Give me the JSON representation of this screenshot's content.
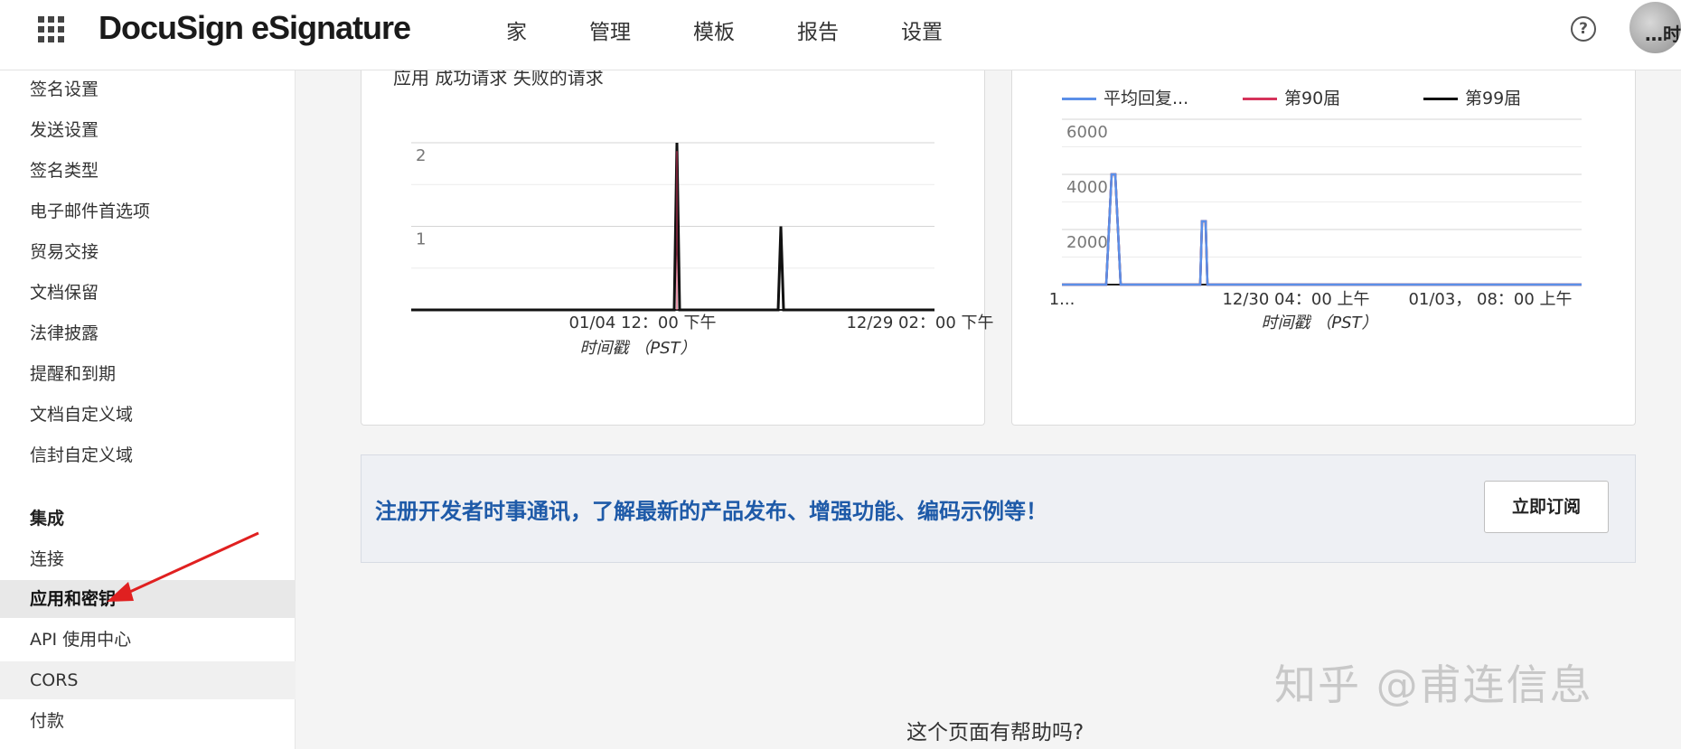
{
  "header": {
    "brand": "DocuSign eSignature",
    "nav": [
      "家",
      "管理",
      "模板",
      "报告",
      "设置"
    ],
    "help": "?",
    "avatar_text": "…时"
  },
  "sidebar": {
    "items_top": [
      "签名设置",
      "发送设置",
      "签名类型",
      "电子邮件首选项",
      "贸易交接",
      "文档保留",
      "法律披露",
      "提醒和到期",
      "文档自定义域",
      "信封自定义域"
    ],
    "integration_heading": "集成",
    "items_integration": [
      "连接",
      "应用和密钥",
      "API 使用中心",
      "CORS",
      "付款"
    ]
  },
  "chart_left": {
    "title": "应用 成功请求 失败的请求",
    "xaxis_title": "时间戳 （PST）"
  },
  "chart_right": {
    "xaxis_title": "时间戳 （PST）"
  },
  "chart_data": [
    {
      "type": "line",
      "title": "应用 成功请求 失败的请求",
      "xlabel": "时间戳 （PST）",
      "ylabel": "",
      "ylim": [
        0,
        2
      ],
      "yticks": [
        1,
        2
      ],
      "xtick_labels": [
        "01/04 12：00 下午",
        "12/29 02：00 下午"
      ],
      "series": [
        {
          "values": [
            0,
            0,
            0,
            0,
            2,
            0,
            0,
            1,
            0,
            0,
            0,
            0
          ]
        }
      ],
      "grid": true,
      "colors": [
        "#111111"
      ]
    },
    {
      "type": "line",
      "title": "",
      "xlabel": "时间戳 （PST）",
      "ylabel": "",
      "ylim": [
        0,
        6000
      ],
      "yticks": [
        2000,
        4000,
        6000
      ],
      "xtick_labels": [
        "1...",
        "12/30 04：00 上午",
        "01/03， 08：00 上午"
      ],
      "legend": "top",
      "series": [
        {
          "name": "平均回复...",
          "color": "#5b8fe8",
          "values": [
            0,
            4000,
            0,
            0,
            2300,
            0,
            0,
            0,
            0,
            0,
            0,
            0
          ]
        },
        {
          "name": "第90届",
          "color": "#d6335b",
          "values": [
            0,
            4000,
            0,
            0,
            2300,
            0,
            0,
            0,
            0,
            0,
            0,
            0
          ]
        },
        {
          "name": "第99届",
          "color": "#111111",
          "values": [
            0,
            4000,
            0,
            0,
            2300,
            0,
            0,
            0,
            0,
            0,
            0,
            0
          ]
        }
      ],
      "grid": true
    }
  ],
  "banner": {
    "text": "注册开发者时事通讯，了解最新的产品发布、增强功能、编码示例等！",
    "button": "立即订阅"
  },
  "footer": {
    "question": "这个页面有帮助吗?"
  },
  "watermark": {
    "zhihu": "知乎 @甫连信息"
  }
}
